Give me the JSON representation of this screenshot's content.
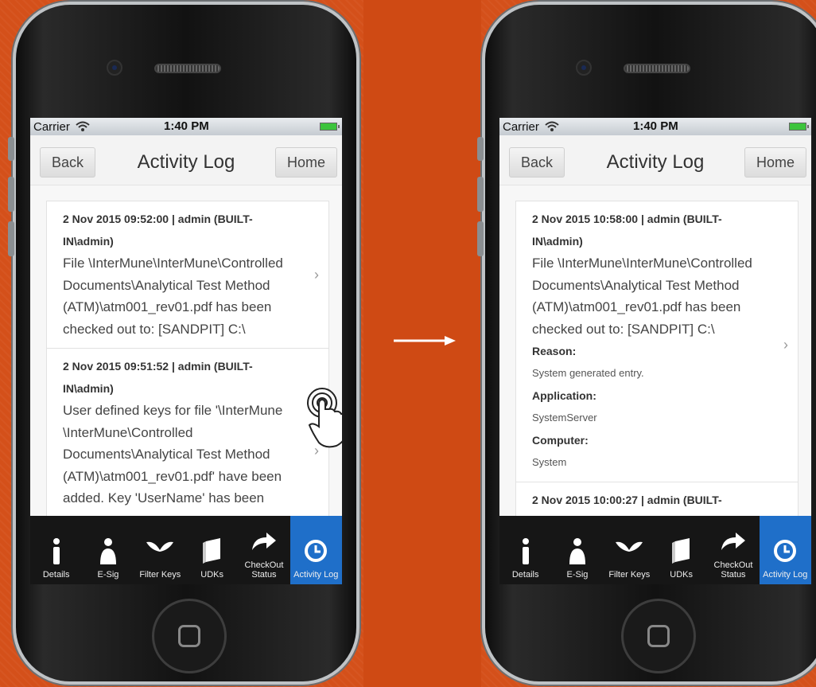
{
  "colors": {
    "background": "#d4501a",
    "active_tab": "#1f6fc9"
  },
  "screens": [
    {
      "statusbar": {
        "carrier": "Carrier",
        "time": "1:40 PM"
      },
      "nav": {
        "back": "Back",
        "title": "Activity Log",
        "home": "Home"
      },
      "items": [
        {
          "meta": "2 Nov 2015 09:52:00 | admin (BUILT-IN\\admin)",
          "message": "File \\InterMune\\InterMune\\Controlled Documents\\Analytical Test Method (ATM)\\atm001_rev01.pdf has been checked out to: [SANDPIT] C:\\"
        },
        {
          "meta": "2 Nov 2015 09:51:52 | admin (BUILT-IN\\admin)",
          "message": "User defined keys for file '\\InterMune \\InterMune\\Controlled Documents\\Analytical Test Method (ATM)\\atm001_rev01.pdf' have been added. Key 'UserName' has been"
        }
      ],
      "tabs": [
        {
          "label": "Details",
          "icon": "info-icon"
        },
        {
          "label": "E-Sig",
          "icon": "person-icon"
        },
        {
          "label": "Filter Keys",
          "icon": "filter-icon"
        },
        {
          "label": "UDKs",
          "icon": "book-icon"
        },
        {
          "label": "CheckOut Status",
          "icon": "share-icon"
        },
        {
          "label": "Activity Log",
          "icon": "clock-icon"
        }
      ]
    },
    {
      "statusbar": {
        "carrier": "Carrier",
        "time": "1:40 PM"
      },
      "nav": {
        "back": "Back",
        "title": "Activity Log",
        "home": "Home"
      },
      "items": [
        {
          "meta": "2 Nov 2015 10:58:00 | admin (BUILT-IN\\admin)",
          "message": "File \\InterMune\\InterMune\\Controlled Documents\\Analytical Test Method (ATM)\\atm001_rev01.pdf has been checked out to: [SANDPIT] C:\\",
          "reason_label": "Reason:",
          "reason": "System generated entry.",
          "application_label": "Application:",
          "application": "SystemServer",
          "computer_label": "Computer:",
          "computer": "System"
        },
        {
          "meta": "2 Nov 2015 10:00:27 | admin (BUILT-"
        }
      ],
      "tabs": [
        {
          "label": "Details",
          "icon": "info-icon"
        },
        {
          "label": "E-Sig",
          "icon": "person-icon"
        },
        {
          "label": "Filter Keys",
          "icon": "filter-icon"
        },
        {
          "label": "UDKs",
          "icon": "book-icon"
        },
        {
          "label": "CheckOut Status",
          "icon": "share-icon"
        },
        {
          "label": "Activity Log",
          "icon": "clock-icon"
        }
      ]
    }
  ]
}
